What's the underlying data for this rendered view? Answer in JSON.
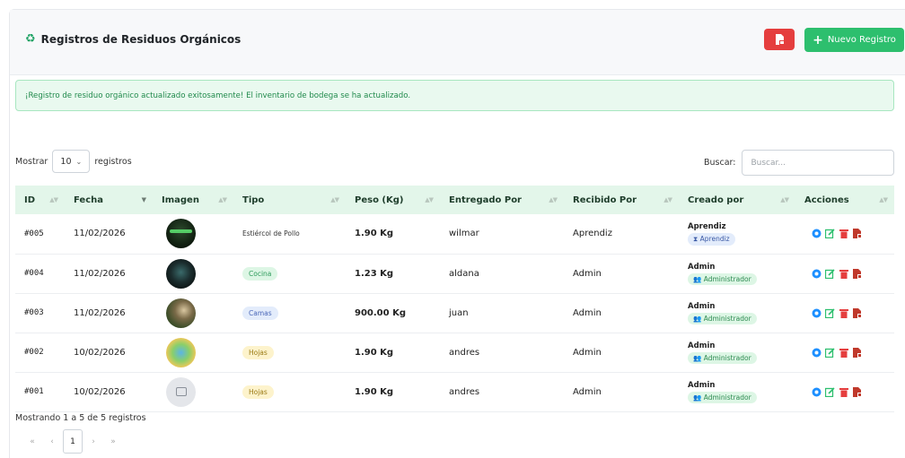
{
  "header": {
    "title": "Registros de Residuos Orgánicos",
    "new_button_label": "Nuevo Registro"
  },
  "alert": {
    "message": "¡Registro de residuo orgánico actualizado exitosamente! El inventario de bodega se ha actualizado."
  },
  "controls": {
    "show_label": "Mostrar",
    "page_size": "10",
    "records_label": "registros",
    "search_label": "Buscar:",
    "search_placeholder": "Buscar..."
  },
  "table": {
    "columns": [
      "ID",
      "Fecha",
      "Imagen",
      "Tipo",
      "Peso (Kg)",
      "Entregado Por",
      "Recibido Por",
      "Creado por",
      "Acciones"
    ],
    "rows": [
      {
        "id": "#005",
        "fecha": "11/02/2026",
        "tipo": "Estiércol de Pollo",
        "peso": "1.90 Kg",
        "entregado": "wilmar",
        "recibido": "Aprendiz",
        "creador": "Aprendiz",
        "rol": "Aprendiz"
      },
      {
        "id": "#004",
        "fecha": "11/02/2026",
        "tipo": "Cocina",
        "peso": "1.23 Kg",
        "entregado": "aldana",
        "recibido": "Admin",
        "creador": "Admin",
        "rol": "Administrador"
      },
      {
        "id": "#003",
        "fecha": "11/02/2026",
        "tipo": "Camas",
        "peso": "900.00 Kg",
        "entregado": "juan",
        "recibido": "Admin",
        "creador": "Admin",
        "rol": "Administrador"
      },
      {
        "id": "#002",
        "fecha": "10/02/2026",
        "tipo": "Hojas",
        "peso": "1.90 Kg",
        "entregado": "andres",
        "recibido": "Admin",
        "creador": "Admin",
        "rol": "Administrador"
      },
      {
        "id": "#001",
        "fecha": "10/02/2026",
        "tipo": "Hojas",
        "peso": "1.90 Kg",
        "entregado": "andres",
        "recibido": "Admin",
        "creador": "Admin",
        "rol": "Administrador"
      }
    ]
  },
  "footer": {
    "info": "Mostrando 1 a 5 de 5 registros",
    "current_page": "1"
  },
  "colors": {
    "accent_green": "#2dbf6e",
    "danger_red": "#e53e3e",
    "alert_bg": "#e9f9ef"
  }
}
